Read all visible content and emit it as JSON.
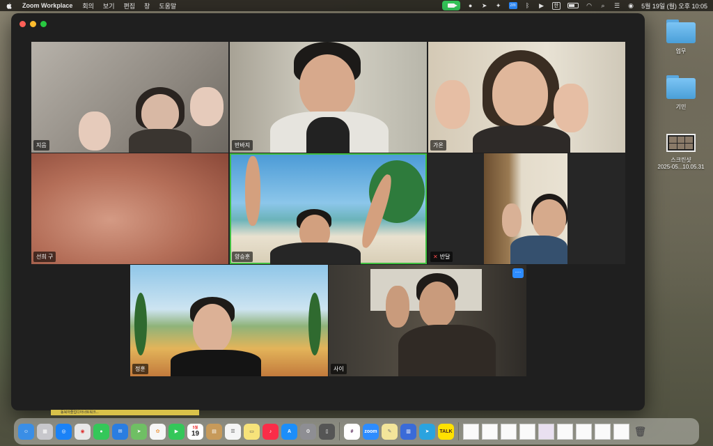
{
  "menubar": {
    "app_name": "Zoom Workplace",
    "menus": [
      "회의",
      "보기",
      "편집",
      "창",
      "도움말"
    ],
    "zoom_badge": "zm",
    "lang_badge": "한",
    "datetime": "5월 19일 (월) 오후 10:05"
  },
  "desktop": {
    "items": [
      {
        "label": "업무",
        "icon": "folder-icon"
      },
      {
        "label": "기민",
        "icon": "folder-icon"
      },
      {
        "label": "스크린샷",
        "sublabel": "2025-05...10.05.31",
        "icon": "screenshot-thumbnail"
      }
    ]
  },
  "meeting": {
    "participants": [
      {
        "name": "지음"
      },
      {
        "name": "반바지"
      },
      {
        "name": "가온"
      },
      {
        "name": "선희 구"
      },
      {
        "name": "양승훈",
        "active_speaker": true
      },
      {
        "name": "반달",
        "muted": true
      },
      {
        "name": "정훈"
      },
      {
        "name": "사이"
      }
    ],
    "more_button": "···"
  },
  "notification_strip": "동북아졸업디아너트워크...",
  "dock": {
    "calendar_day": "19",
    "calendar_month": "5월",
    "apps": [
      "finder",
      "launchpad",
      "safari",
      "chrome",
      "messages",
      "mail",
      "maps",
      "photos",
      "facetime",
      "calendar",
      "wallet",
      "reminders",
      "notes",
      "music",
      "app-store",
      "settings",
      "iphone-mirroring",
      "slack",
      "zoom",
      "notes-yellow",
      "notebook",
      "telegram",
      "kakaotalk"
    ],
    "zoom_label": "zoom",
    "talk_label": "TALK",
    "colors": {
      "finder": "#3a8ee6",
      "chrome": "#e8e8e8",
      "messages": "#34c759",
      "mail": "#2a7de1",
      "facetime": "#34c759",
      "music": "#fa2d48",
      "app_store": "#1c8ef9",
      "slack": "#ffffff",
      "zoom": "#2d8cff",
      "telegram": "#2aa3df",
      "kakaotalk": "#ffe100"
    }
  },
  "colors": {
    "window_bg": "#1f1f1f",
    "active_speaker_border": "#3fbf3f",
    "traffic_red": "#ff5f57",
    "traffic_yellow": "#febc2e",
    "traffic_green": "#28c840",
    "zoom_accent": "#2d8cff"
  }
}
